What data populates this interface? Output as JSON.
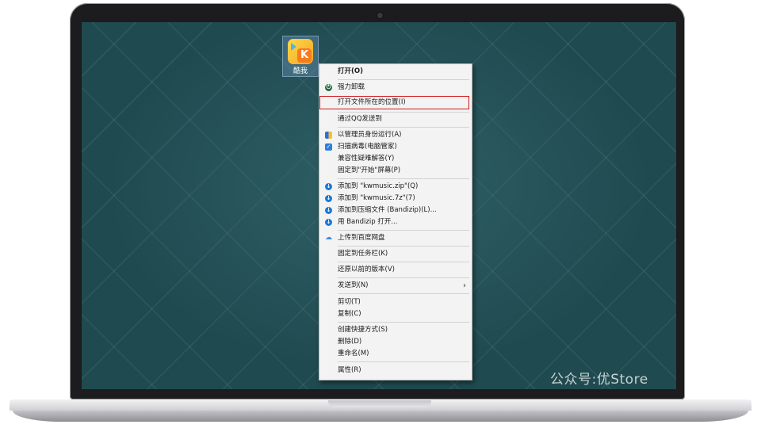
{
  "desktop": {
    "icon_label": "酷我"
  },
  "context_menu": {
    "items": [
      {
        "label": "打开(O)"
      },
      {
        "label": "强力卸载"
      },
      {
        "label": "打开文件所在的位置(I)"
      },
      {
        "label": "通过QQ发送到"
      },
      {
        "label": "以管理员身份运行(A)"
      },
      {
        "label": "扫描病毒(电脑管家)"
      },
      {
        "label": "兼容性疑难解答(Y)"
      },
      {
        "label": "固定到\"开始\"屏幕(P)"
      },
      {
        "label": "添加到 \"kwmusic.zip\"(Q)"
      },
      {
        "label": "添加到 \"kwmusic.7z\"(7)"
      },
      {
        "label": "添加到压缩文件 (Bandizip)(L)..."
      },
      {
        "label": "用 Bandizip 打开..."
      },
      {
        "label": "上传到百度网盘"
      },
      {
        "label": "固定到任务栏(K)"
      },
      {
        "label": "还原以前的版本(V)"
      },
      {
        "label": "发送到(N)"
      },
      {
        "label": "剪切(T)"
      },
      {
        "label": "复制(C)"
      },
      {
        "label": "创建快捷方式(S)"
      },
      {
        "label": "删除(D)"
      },
      {
        "label": "重命名(M)"
      },
      {
        "label": "属性(R)"
      }
    ],
    "highlight_color": "#d0171b"
  },
  "watermark": "公众号:优Store"
}
